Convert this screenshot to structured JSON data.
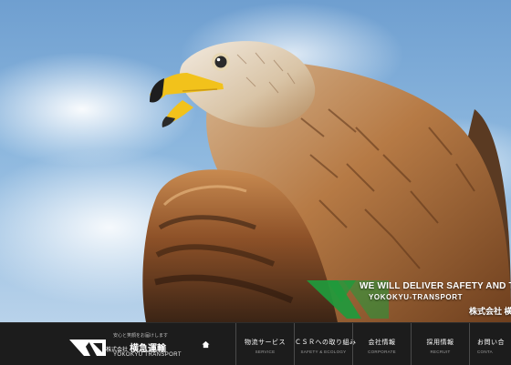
{
  "banner": {
    "tagline": "WE WILL DELIVER SAFETY AND THE S",
    "company_en": "YOKOKYU-TRANSPORT",
    "company_jp": "株式会社 横"
  },
  "header": {
    "logo": {
      "slogan": "安心と笑顔をお届けします",
      "company_prefix": "株式会社",
      "company_name": "横急運輸",
      "company_en": "YOKOKYU TRANSPORT"
    },
    "home_icon": "home-icon",
    "nav": [
      {
        "label": "物流サービス",
        "sub": "SERVICE"
      },
      {
        "label": "ＣＳＲへの取り組み",
        "sub": "SAFETY & ECOLOGY"
      },
      {
        "label": "会社情報",
        "sub": "CORPORATE"
      },
      {
        "label": "採用情報",
        "sub": "RECRUIT"
      },
      {
        "label": "お問い合",
        "sub": "CONTA"
      }
    ]
  },
  "colors": {
    "accent_green": "#1f9a3c",
    "navbar_bg": "#1c1c1c"
  }
}
